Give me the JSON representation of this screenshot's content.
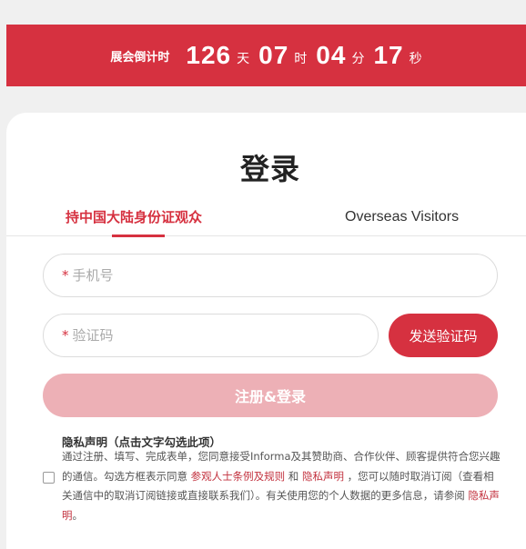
{
  "countdown": {
    "label": "展会倒计时",
    "days": "126",
    "days_unit": "天",
    "hours": "07",
    "hours_unit": "时",
    "minutes": "04",
    "minutes_unit": "分",
    "seconds": "17",
    "seconds_unit": "秒"
  },
  "login": {
    "title": "登录",
    "tabs": [
      {
        "label": "持中国大陆身份证观众",
        "active": true
      },
      {
        "label": "Overseas Visitors",
        "active": false
      }
    ],
    "phone": {
      "required_mark": "*",
      "placeholder": "手机号"
    },
    "code": {
      "required_mark": "*",
      "placeholder": "验证码"
    },
    "send_code_label": "发送验证码",
    "submit_label": "注册&登录"
  },
  "privacy": {
    "title": "隐私声明（点击文字勾选此项）",
    "text_1": "通过注册、填写、完成表单，您同意接受Informa及其赞助商、合作伙伴、顾客提供符合您兴趣的通信。勾选方框表示同意 ",
    "link_terms": "参观人士条例及规则",
    "text_2": " 和 ",
    "link_privacy": "隐私声明",
    "text_3": " ，您可以随时取消订阅（查看相关通信中的取消订阅链接或直接联系我们）。有关使用您的个人数据的更多信息，请参阅 ",
    "link_privacy_2": "隐私声明",
    "text_4": "。",
    "checked": false
  },
  "colors": {
    "accent": "#d63140",
    "submit_disabled": "#edb0b6",
    "background": "#f0f0f0"
  }
}
